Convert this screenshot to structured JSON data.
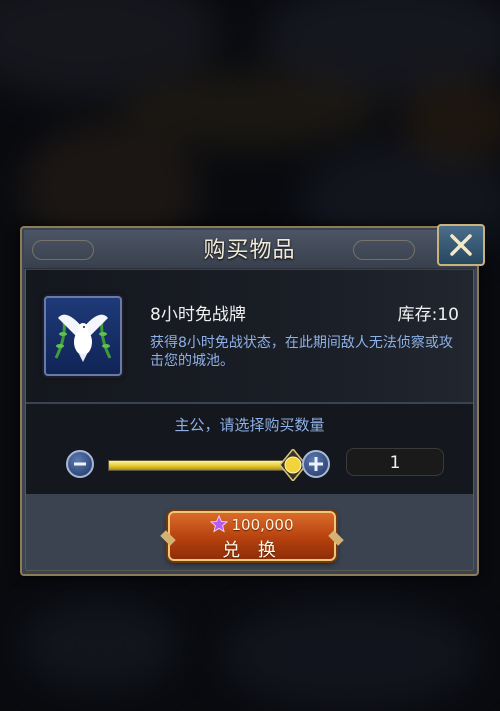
{
  "dialog": {
    "title": "购买物品",
    "close_icon": "close-x-icon"
  },
  "item": {
    "name": "8小时免战牌",
    "stock_label": "库存:10",
    "description": "获得8小时免战状态，在此期间敌人无法侦察或攻击您的城池。",
    "icon": "white-dove-icon"
  },
  "quantity": {
    "prompt": "主公，请选择购买数量",
    "value": "1",
    "slider_fraction": 1.0
  },
  "redeem": {
    "cost": "100,000",
    "currency_icon": "purple-star-icon",
    "label": "兑 换"
  },
  "colors": {
    "accent_blue_text": "#8db0e6",
    "button_orange": "#c04a14",
    "frame_gold": "#8b7c55"
  }
}
